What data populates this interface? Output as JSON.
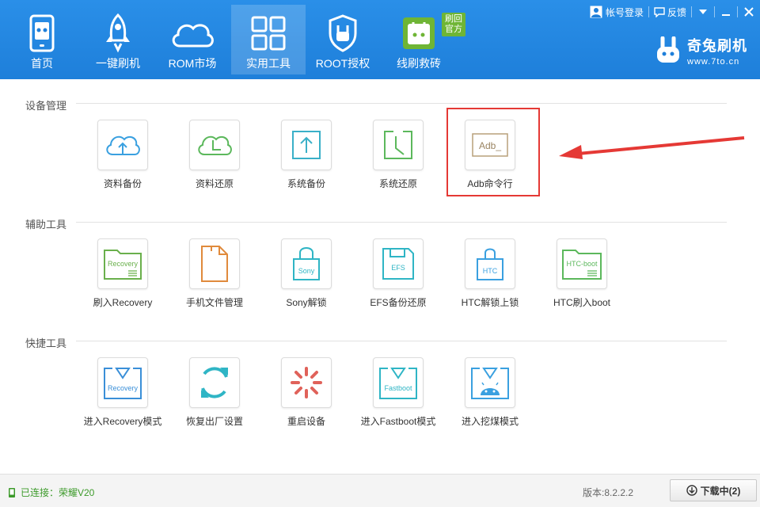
{
  "nav": {
    "items": [
      {
        "label": "首页",
        "icon": "phone-icon"
      },
      {
        "label": "一键刷机",
        "icon": "rocket-icon"
      },
      {
        "label": "ROM市场",
        "icon": "cloud-icon"
      },
      {
        "label": "实用工具",
        "icon": "grid-icon"
      },
      {
        "label": "ROOT授权",
        "icon": "shield-icon"
      },
      {
        "label": "线刷救砖",
        "icon": "rescue-icon"
      }
    ],
    "active": "实用工具",
    "rescue_badge": "刷回官方"
  },
  "top_right": {
    "login": "帐号登录",
    "feedback": "反馈"
  },
  "brand": {
    "name": "奇兔刷机",
    "url": "www.7to.cn"
  },
  "sections": {
    "device": {
      "title": "设备管理",
      "tools": [
        {
          "label": "资料备份",
          "icon": "cloud-upload-icon",
          "color": "#3aa0e0"
        },
        {
          "label": "资料还原",
          "icon": "cloud-clock-icon",
          "color": "#5cb85c"
        },
        {
          "label": "系统备份",
          "icon": "upload-box-icon",
          "color": "#3ab0c8"
        },
        {
          "label": "系统还原",
          "icon": "clock-box-icon",
          "color": "#5cb85c"
        },
        {
          "label": "Adb命令行",
          "icon": "terminal-icon",
          "icon_text": "Adb_",
          "color": "#b8a07a"
        }
      ]
    },
    "aux": {
      "title": "辅助工具",
      "tools": [
        {
          "label": "刷入Recovery",
          "icon": "folder-recovery-icon",
          "icon_text": "Recovery",
          "color": "#6ab04c"
        },
        {
          "label": "手机文件管理",
          "icon": "document-icon",
          "color": "#e08a3c"
        },
        {
          "label": "Sony解锁",
          "icon": "lock-sony-icon",
          "icon_text": "Sony",
          "color": "#2fb5c5"
        },
        {
          "label": "EFS备份还原",
          "icon": "floppy-icon",
          "icon_text": "EFS",
          "color": "#2fb5c5"
        },
        {
          "label": "HTC解锁上锁",
          "icon": "lock-htc-icon",
          "icon_text": "HTC",
          "color": "#3aa0e0"
        },
        {
          "label": "HTC刷入boot",
          "icon": "folder-htc-icon",
          "icon_text": "HTC-boot",
          "color": "#5cb85c"
        }
      ]
    },
    "quick": {
      "title": "快捷工具",
      "tools": [
        {
          "label": "进入Recovery模式",
          "icon": "recovery-mode-icon",
          "icon_text": "Recovery",
          "color": "#3a8fd8"
        },
        {
          "label": "恢复出厂设置",
          "icon": "refresh-icon",
          "color": "#2fb5c5"
        },
        {
          "label": "重启设备",
          "icon": "spinner-icon",
          "color": "#e0625a"
        },
        {
          "label": "进入Fastboot模式",
          "icon": "fastboot-mode-icon",
          "icon_text": "Fastboot",
          "color": "#2fb5c5"
        },
        {
          "label": "进入挖煤模式",
          "icon": "android-mode-icon",
          "color": "#3aa0e0"
        }
      ]
    }
  },
  "status": {
    "connected": "已连接：荣耀V20",
    "version": "版本:8.2.2.2",
    "download": "下载中(2)"
  }
}
